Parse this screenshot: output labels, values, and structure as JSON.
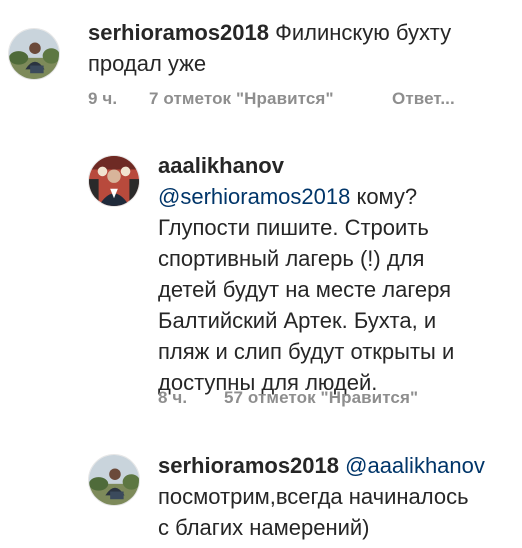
{
  "comments": [
    {
      "username": "serhioramos2018",
      "line1_rest": "Филинскую бухту",
      "line2": "продал уже",
      "time": "9 ч.",
      "likes": "7 отметок \"Нравится\"",
      "reply": "Ответ..."
    },
    {
      "username": "aaalikhanov",
      "mention": "@serhioramos2018",
      "line2_rest": " кому?",
      "lines": [
        "Глупости пишите. Строить",
        "спортивный лагерь (!) для",
        "детей будут на месте лагеря",
        "Балтийский Артек. Бухта, и",
        "пляж и слип будут открыты и",
        "доступны для людей."
      ],
      "time": "8 ч.",
      "likes": "57 отметок \"Нравится\""
    },
    {
      "username": "serhioramos2018",
      "mention": "@aaalikhanov",
      "lines": [
        "посмотрим,всегда начиналось",
        "с благих намерений)"
      ]
    }
  ],
  "icons": {
    "avatar1": "user-avatar-icon",
    "avatar2": "user-avatar-icon",
    "avatar3": "user-avatar-icon"
  }
}
